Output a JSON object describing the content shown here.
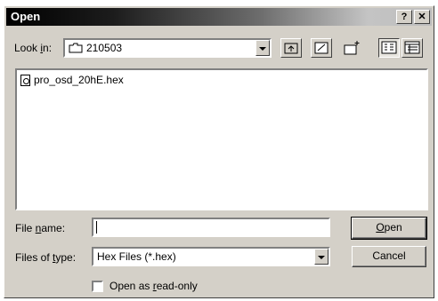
{
  "window": {
    "title": "Open",
    "help_label": "?",
    "close_label": "✕"
  },
  "look_in": {
    "label_prefix": "Look ",
    "label_key": "i",
    "label_suffix": "n:",
    "value": "210503"
  },
  "toolbar": [
    "up-one-level",
    "desktop",
    "create-new-folder",
    "list-view",
    "details-view"
  ],
  "files": [
    {
      "name": "pro_osd_20hE.hex"
    }
  ],
  "file_name": {
    "label_prefix": "File ",
    "label_key": "n",
    "label_suffix": "ame:",
    "value": ""
  },
  "files_of_type": {
    "label_prefix": "Files of ",
    "label_key": "t",
    "label_suffix": "ype:",
    "value": "Hex Files (*.hex)"
  },
  "buttons": {
    "open_key": "O",
    "open_rest": "pen",
    "cancel": "Cancel"
  },
  "read_only": {
    "prefix": "Open as ",
    "key": "r",
    "suffix": "ead-only",
    "checked": false
  }
}
